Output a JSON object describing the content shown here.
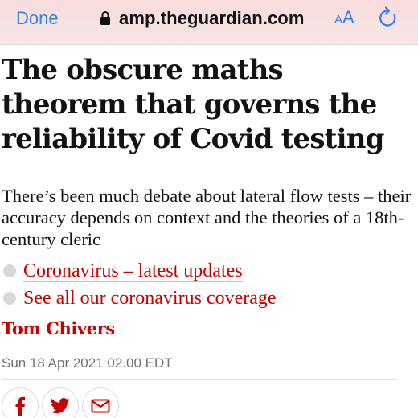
{
  "browser": {
    "done_label": "Done",
    "url": "amp.theguardian.com",
    "text_size_label_small": "A",
    "text_size_label_large": "A",
    "accent_color": "#2f7ff0"
  },
  "article": {
    "headline": "The obscure maths theorem that governs the reliability of Covid testing",
    "standfirst": "There’s been much debate about lateral flow tests – their accuracy depends on context and the theories of a 18th-century cleric",
    "related_links": [
      {
        "label": "Coronavirus – latest updates"
      },
      {
        "label": "See all our coronavirus coverage"
      }
    ],
    "byline": "Tom Chivers",
    "dateline": "Sun 18 Apr 2021 02.00 EDT",
    "link_color": "#c70000"
  },
  "share": {
    "buttons": [
      {
        "icon": "facebook-icon"
      },
      {
        "icon": "twitter-icon"
      },
      {
        "icon": "email-icon"
      }
    ]
  }
}
